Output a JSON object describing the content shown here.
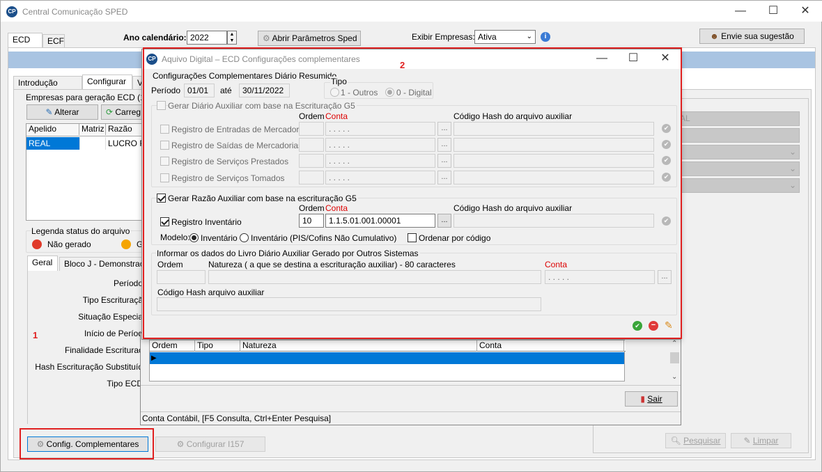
{
  "main": {
    "title": "Central Comunicação SPED",
    "logo": "CP",
    "tabs": [
      "ECD",
      "ECF"
    ],
    "ano_label": "Ano calendário:",
    "ano_value": "2022",
    "abrir_button": "Abrir Parâmetros Sped",
    "exibir_label": "Exibir Empresas:",
    "exibir_value": "Ativa",
    "sugestao_button": "Envie sua sugestão",
    "subtabs": [
      "Introdução Geral",
      "Configurar",
      "Ve"
    ],
    "empresas_title": "Empresas para geração ECD (1)",
    "alterar_button": "Alterar",
    "carregar_button": "Carreg",
    "grid_headers": [
      "Apelido",
      "Matriz",
      "Razão"
    ],
    "grid_row": [
      "REAL",
      "",
      "LUCRO R"
    ],
    "legend_title": "Legenda status do arquivo",
    "legend_nao_gerado": "Não gerado",
    "legend_g": "G",
    "bottom_tabs": [
      "Geral",
      "Bloco J - Demonstraç"
    ],
    "fields": [
      "Período",
      "Tipo Escrituraçã",
      "Situação Especia",
      "Início de Períod",
      "Finalidade Escrituraç",
      "Hash Escrituração Substituíd",
      "Tipo ECD"
    ],
    "annotation_1": "1",
    "config_button": "Config. Complementares",
    "configurar_button": "Configurar I157",
    "right_item": "AL",
    "pesquisar_button": "Pesquisar",
    "limpar_button": "Limpar"
  },
  "dialog": {
    "title": "Aquivo Digital – ECD Configurações complementares",
    "annotation_2": "2",
    "resumo_title": "Configurações Complementares Diário Resumido",
    "periodo_label": "Período",
    "periodo_inicio": "01/01",
    "ate_label": "até",
    "periodo_fim": "30/11/2022",
    "tipo_label": "Tipo",
    "tipo_outros": "1 - Outros",
    "tipo_digital": "0 - Digital",
    "diario_aux_label": "Gerar Diário Auxiliar com base  na Escrituração G5",
    "ordem_label": "Ordem",
    "conta_label": "Conta",
    "hash_label": "Código Hash do arquivo auxiliar",
    "conta_placeholder": ". . . . .",
    "diario_rows": [
      "Registro de Entradas de Mercadorias",
      "Registro de Saídas de Mercadorias",
      "Registro de Serviços Prestados",
      "Registro de Serviços Tomados"
    ],
    "razao_aux_label": "Gerar Razão Auxiliar com base na escrituração G5",
    "inventario_label": "Registro Inventário",
    "inventario_ordem": "10",
    "inventario_conta": "1.1.5.01.001.00001",
    "modelo_label": "Modelo:",
    "modelo_inventario": "Inventário",
    "modelo_pis": "Inventário (PIS/Cofins Não Cumulativo)",
    "ordenar_label": "Ordenar por código",
    "outros_title": "Informar os dados do Livro Diário Auxiliar Gerado por Outros Sistemas",
    "outros_ordem": "Ordem",
    "outros_natureza": "Natureza ( a que se destina a escrituração auxiliar) - 80 caracteres",
    "outros_conta": "Conta",
    "outros_hash": "Código Hash arquivo auxiliar",
    "ok_icon": "✔",
    "cancel_icon": "−",
    "erase_icon": "✎"
  },
  "back_dialog": {
    "grid_headers": [
      "Ordem",
      "Tipo",
      "Natureza",
      "Conta"
    ],
    "sair_button": "Sair",
    "status": "Conta Contábil, [F5 Consulta, Ctrl+Enter Pesquisa]"
  },
  "colors": {
    "accent": "#0078d7",
    "annotation": "#e02020",
    "header_band": "#a9c4e2"
  }
}
